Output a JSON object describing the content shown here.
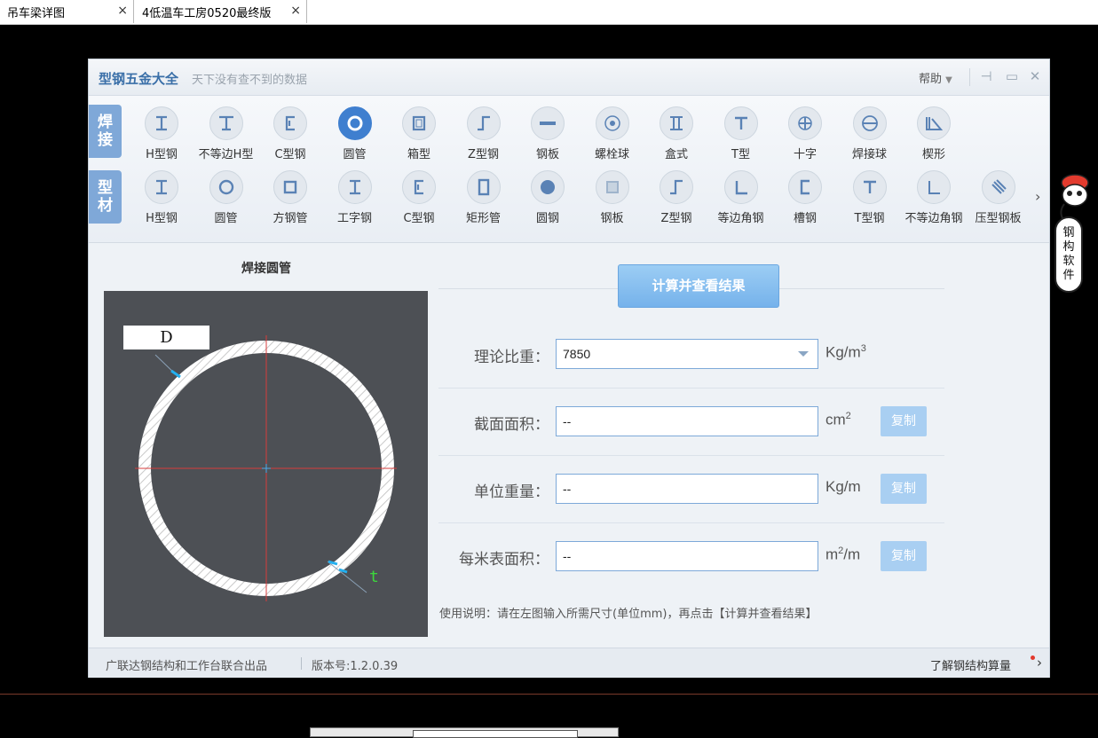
{
  "tabs": [
    {
      "label": "吊车梁详图"
    },
    {
      "label": "4低温车工房0520最终版"
    }
  ],
  "window": {
    "title": "型钢五金大全",
    "subtitle": "天下没有查不到的数据",
    "help_label": "帮助"
  },
  "toolbar": {
    "weld_label": "焊接",
    "profile_label": "型材",
    "weld_items": [
      "H型钢",
      "不等边H型",
      "C型钢",
      "圆管",
      "箱型",
      "Z型钢",
      "钢板",
      "螺栓球",
      "盒式",
      "T型",
      "十字",
      "焊接球",
      "楔形"
    ],
    "profile_items": [
      "H型钢",
      "圆管",
      "方钢管",
      "工字钢",
      "C型钢",
      "矩形管",
      "圆钢",
      "钢板",
      "Z型钢",
      "等边角钢",
      "槽钢",
      "T型钢",
      "不等边角钢",
      "压型钢板"
    ],
    "active_item": "圆管"
  },
  "diagram": {
    "title": "焊接圆管",
    "d_label": "D",
    "t_label": "t"
  },
  "calc": {
    "button_label": "计算并查看结果",
    "fields": [
      {
        "label": "理论比重：",
        "value": "7850",
        "unit": "Kg/m",
        "unit_sup": "3"
      },
      {
        "label": "截面面积：",
        "value": "--",
        "unit": "cm",
        "unit_sup": "2",
        "copy_label": "复制"
      },
      {
        "label": "单位重量：",
        "value": "--",
        "unit": "Kg/m",
        "copy_label": "复制"
      },
      {
        "label": "每米表面积：",
        "value": "--",
        "unit": "m",
        "unit_sup": "2",
        "unit_suffix": "/m",
        "copy_label": "复制"
      }
    ],
    "usage": "使用说明：请在左图输入所需尺寸(单位mm)，再点击【计算并查看结果】"
  },
  "footer": {
    "credit": "广联达钢结构和工作台联合出品",
    "version": "版本号:1.2.0.39",
    "learn_more": "了解钢结构算量"
  },
  "mascot": {
    "text": [
      "钢",
      "构",
      "软",
      "件"
    ]
  },
  "colors": {
    "accent": "#3f7fcf",
    "button": "#75b2eb",
    "copy_button": "#a9cff2"
  }
}
